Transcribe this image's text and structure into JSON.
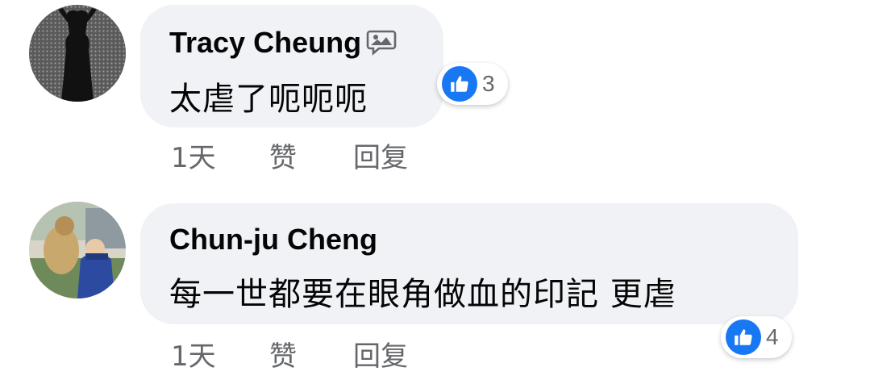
{
  "comments": [
    {
      "author": "Tracy Cheung",
      "author_badge_icon": "chat-bubble-image-icon",
      "text": "太虐了呃呃呃",
      "reaction_icon": "thumbs-up-icon",
      "reaction_count": "3",
      "time": "1天",
      "like_label": "赞",
      "reply_label": "回复"
    },
    {
      "author": "Chun-ju Cheng",
      "text": "每一世都要在眼角做血的印記 更虐",
      "reaction_icon": "thumbs-up-icon",
      "reaction_count": "4",
      "time": "1天",
      "like_label": "赞",
      "reply_label": "回复"
    }
  ],
  "colors": {
    "bubble": "#f0f2f5",
    "like_blue": "#1877f2",
    "meta_gray": "#65676b",
    "text": "#050505"
  }
}
